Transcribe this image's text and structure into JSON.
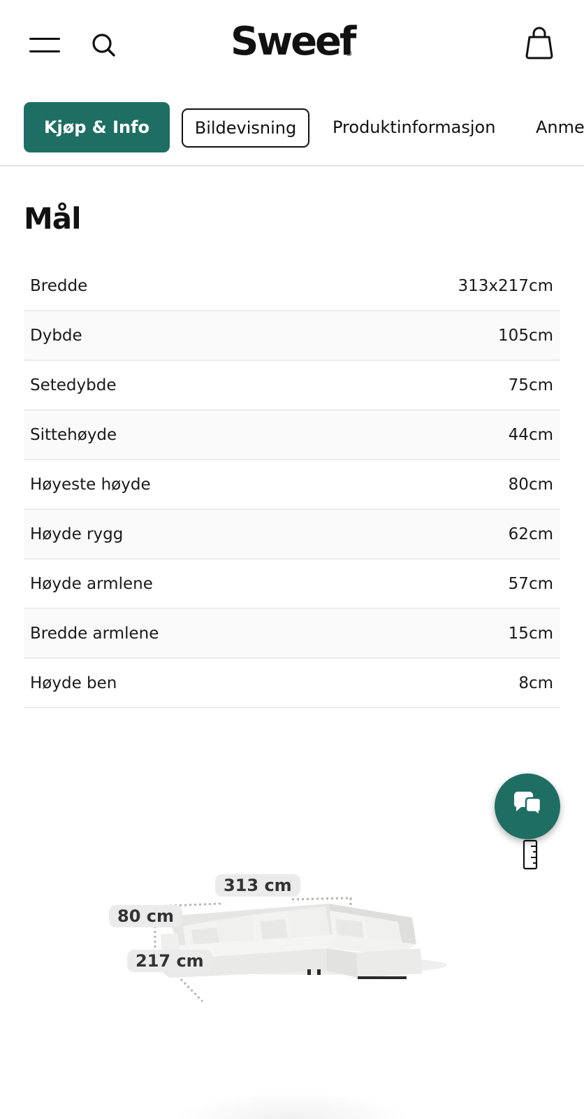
{
  "header": {
    "logo": "Sweef",
    "logo_reg": "®",
    "icons": [
      "hamburger-icon",
      "search-icon",
      "bag-icon"
    ]
  },
  "tabs": [
    {
      "label": "Kjøp & Info",
      "active": true
    },
    {
      "label": "Bildevisning",
      "active": false
    },
    {
      "label": "Produktinformasjon",
      "active": false
    },
    {
      "label": "Anme",
      "active": false
    }
  ],
  "dimensions": {
    "title": "Mål",
    "rows": [
      {
        "label": "Bredde",
        "value": "313x217cm"
      },
      {
        "label": "Dybde",
        "value": "105cm"
      },
      {
        "label": "Setedybde",
        "value": "75cm"
      },
      {
        "label": "Sittehøyde",
        "value": "44cm"
      },
      {
        "label": "Høyeste høyde",
        "value": "80cm"
      },
      {
        "label": "Høyde rygg",
        "value": "62cm"
      },
      {
        "label": "Høyde armlene",
        "value": "57cm"
      },
      {
        "label": "Bredde armlene",
        "value": "15cm"
      },
      {
        "label": "Høyde ben",
        "value": "8cm"
      }
    ]
  },
  "illustration": {
    "width_label": "313 cm",
    "height_label": "80 cm",
    "depth_label": "217 cm"
  },
  "colors": {
    "accent": "#1f6e64",
    "text": "#111111",
    "row_alt": "#fafafa"
  },
  "floating": {
    "chat_icon": "chat-bubbles-icon",
    "ruler_icon": "ruler-icon"
  }
}
